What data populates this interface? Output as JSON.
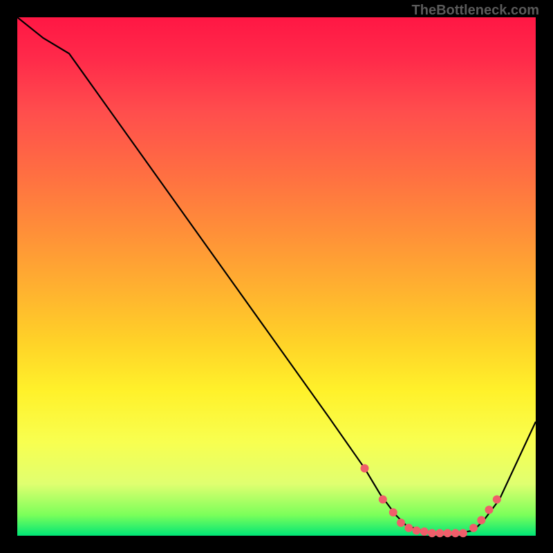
{
  "watermark": "TheBottleneck.com",
  "chart_data": {
    "type": "line",
    "title": "",
    "xlabel": "",
    "ylabel": "",
    "xlim": [
      0,
      100
    ],
    "ylim": [
      0,
      100
    ],
    "grid": false,
    "background": {
      "type": "vertical-gradient",
      "stops": [
        {
          "pos": 0.0,
          "color": "#ff1744"
        },
        {
          "pos": 0.5,
          "color": "#ffb030"
        },
        {
          "pos": 0.8,
          "color": "#fff12a"
        },
        {
          "pos": 1.0,
          "color": "#00e676"
        }
      ]
    },
    "series": [
      {
        "name": "bottleneck-curve",
        "color": "#000000",
        "x": [
          0,
          5,
          10,
          20,
          30,
          40,
          50,
          60,
          67,
          70,
          73,
          75,
          78,
          80,
          82,
          85,
          88,
          90,
          93,
          100
        ],
        "y": [
          100,
          96,
          93,
          79,
          65,
          51,
          37,
          23,
          13,
          8,
          4,
          2,
          1,
          0.5,
          0.5,
          0.5,
          1,
          3,
          7,
          22
        ]
      }
    ],
    "markers": {
      "name": "highlight-points",
      "color": "#ef5e6a",
      "radius": 6,
      "x": [
        67,
        70.5,
        72.5,
        74,
        75.5,
        77,
        78.5,
        80,
        81.5,
        83,
        84.5,
        86,
        88,
        89.5,
        91,
        92.5
      ],
      "y": [
        13,
        7,
        4.5,
        2.5,
        1.5,
        1,
        0.8,
        0.5,
        0.5,
        0.5,
        0.5,
        0.5,
        1.5,
        3,
        5,
        7
      ]
    }
  }
}
